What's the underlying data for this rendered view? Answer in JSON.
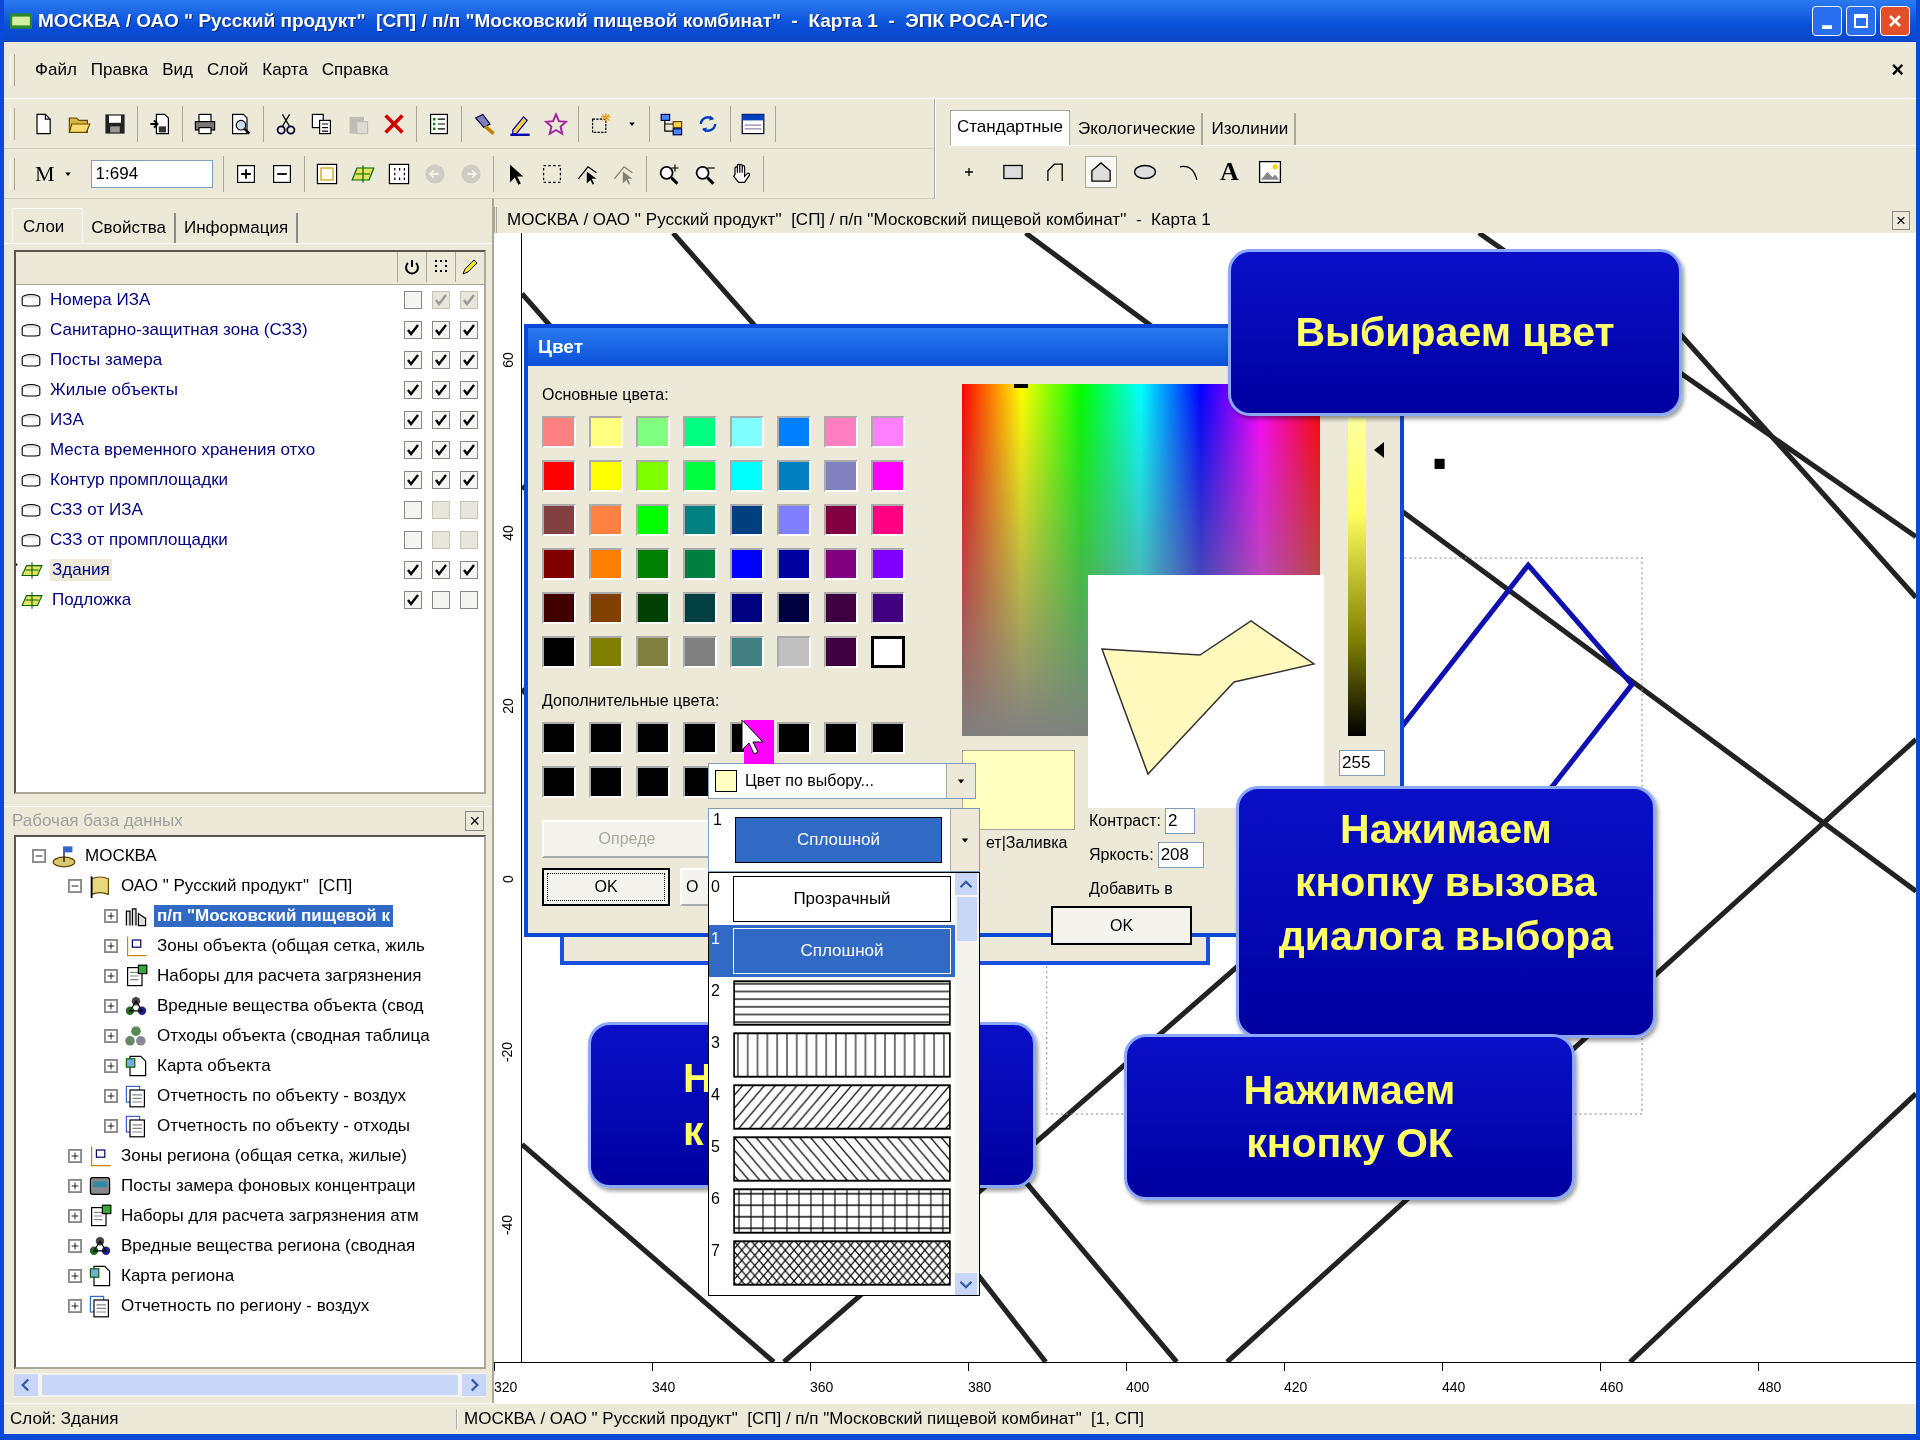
{
  "window": {
    "title": "МОСКВА / ОАО \" Русский продукт\"  [СП] / п/п \"Московский пищевой комбинат\"  -  Карта 1  -  ЭПК РОСА-ГИС"
  },
  "menu": {
    "items": [
      "Файл",
      "Правка",
      "Вид",
      "Слой",
      "Карта",
      "Справка"
    ],
    "close": "×"
  },
  "toolbar": {
    "row_1": [
      [
        {
          "disabled": false
        },
        {
          "disabled": false
        },
        {
          "disabled": false
        }
      ],
      [
        {
          "disabled": false
        }
      ],
      [
        {
          "disabled": false
        },
        {
          "disabled": false
        }
      ],
      [
        {
          "disabled": false
        },
        {
          "disabled": false
        },
        {
          "disabled": true
        },
        {
          "disabled": false
        }
      ],
      [
        {
          "disabled": false
        }
      ],
      [
        {
          "disabled": false
        },
        {
          "disabled": false
        },
        {
          "disabled": false
        }
      ],
      [
        {
          "disabled": false
        },
        {
          "disabled": false
        }
      ],
      [
        {
          "disabled": false
        },
        {
          "disabled": false
        }
      ],
      [
        {
          "disabled": false
        }
      ]
    ],
    "unit": "M",
    "scale": "1:694",
    "row_2": [
      [
        {
          "disabled": false
        },
        {
          "disabled": false
        }
      ],
      [
        {
          "disabled": false
        },
        {
          "disabled": false
        },
        {
          "disabled": false
        },
        {
          "disabled": true
        },
        {
          "disabled": true
        }
      ],
      [
        {
          "disabled": false
        },
        {
          "disabled": false
        },
        {
          "disabled": false
        },
        {
          "disabled": true
        }
      ],
      [
        {
          "disabled": false
        },
        {
          "disabled": false
        },
        {
          "disabled": false
        }
      ]
    ]
  },
  "tool_tabs": [
    {
      "label": "Стандартные",
      "selected": true
    },
    {
      "label": "Экологические",
      "selected": false
    },
    {
      "label": "Изолинии",
      "selected": false
    }
  ],
  "draw_tools": [
    {
      "kind": "icon",
      "selected": false
    },
    {
      "kind": "icon",
      "selected": false
    },
    {
      "kind": "icon",
      "selected": false
    },
    {
      "kind": "icon",
      "selected": true
    },
    {
      "kind": "icon",
      "selected": false
    },
    {
      "kind": "icon",
      "selected": false
    },
    {
      "kind": "text",
      "label": "A",
      "selected": false
    },
    {
      "kind": "icon",
      "selected": false
    }
  ],
  "side_tabs": [
    {
      "label": "Слои",
      "selected": true
    },
    {
      "label": "Свойства",
      "selected": false
    },
    {
      "label": "Информация",
      "selected": false
    }
  ],
  "layers": [
    {
      "name": "Номера ИЗА",
      "kind": "database",
      "selected": false,
      "checks": [
        {
          "checked": false,
          "disabled": false
        },
        {
          "checked": true,
          "disabled": true
        },
        {
          "checked": true,
          "disabled": true
        }
      ]
    },
    {
      "name": "Санитарно-защитная зона (СЗЗ)",
      "kind": "database",
      "selected": false,
      "checks": [
        {
          "checked": true,
          "disabled": false
        },
        {
          "checked": true,
          "disabled": false
        },
        {
          "checked": true,
          "disabled": false
        }
      ]
    },
    {
      "name": "Посты замера",
      "kind": "database",
      "selected": false,
      "checks": [
        {
          "checked": true,
          "disabled": false
        },
        {
          "checked": true,
          "disabled": false
        },
        {
          "checked": true,
          "disabled": false
        }
      ]
    },
    {
      "name": "Жилые объекты",
      "kind": "database",
      "selected": false,
      "checks": [
        {
          "checked": true,
          "disabled": false
        },
        {
          "checked": true,
          "disabled": false
        },
        {
          "checked": true,
          "disabled": false
        }
      ]
    },
    {
      "name": "ИЗА",
      "kind": "database",
      "selected": false,
      "checks": [
        {
          "checked": true,
          "disabled": false
        },
        {
          "checked": true,
          "disabled": false
        },
        {
          "checked": true,
          "disabled": false
        }
      ]
    },
    {
      "name": "Места временного хранения отхо",
      "kind": "database",
      "selected": false,
      "checks": [
        {
          "checked": true,
          "disabled": false
        },
        {
          "checked": true,
          "disabled": false
        },
        {
          "checked": true,
          "disabled": false
        }
      ]
    },
    {
      "name": "Контур промплощадки",
      "kind": "database",
      "selected": false,
      "checks": [
        {
          "checked": true,
          "disabled": false
        },
        {
          "checked": true,
          "disabled": false
        },
        {
          "checked": true,
          "disabled": false
        }
      ]
    },
    {
      "name": "СЗЗ от ИЗА",
      "kind": "database",
      "selected": false,
      "checks": [
        {
          "checked": false,
          "disabled": false
        },
        {
          "checked": false,
          "disabled": true
        },
        {
          "checked": false,
          "disabled": true
        }
      ]
    },
    {
      "name": "СЗЗ от промплощадки",
      "kind": "database",
      "selected": false,
      "checks": [
        {
          "checked": false,
          "disabled": false
        },
        {
          "checked": false,
          "disabled": true
        },
        {
          "checked": false,
          "disabled": true
        }
      ]
    },
    {
      "name": "Здания",
      "kind": "layer",
      "selected": true,
      "checks": [
        {
          "checked": true,
          "disabled": false
        },
        {
          "checked": true,
          "disabled": false
        },
        {
          "checked": true,
          "disabled": false
        }
      ]
    },
    {
      "name": "Подложка",
      "kind": "layer",
      "selected": false,
      "checks": [
        {
          "checked": true,
          "disabled": false
        },
        {
          "checked": false,
          "disabled": false
        },
        {
          "checked": false,
          "disabled": false
        }
      ]
    }
  ],
  "db_panel": {
    "title": "Рабочая база данных",
    "close": "×"
  },
  "tree": [
    {
      "label": "МОСКВА",
      "kind": "city",
      "expanded": true,
      "selected": false,
      "children": [
        {
          "label": "ОАО \" Русский продукт\"  [СП]",
          "kind": "company",
          "expanded": true,
          "selected": false,
          "children": [
            {
              "label": "п/п \"Московский пищевой к",
              "kind": "plant",
              "expanded": false,
              "selected": true
            },
            {
              "label": "Зоны объекта (общая сетка, жиль",
              "kind": "zones",
              "expanded": false,
              "selected": false
            },
            {
              "label": "Наборы для расчета загрязнения",
              "kind": "sets",
              "expanded": false,
              "selected": false
            },
            {
              "label": "Вредные вещества объекта (свод",
              "kind": "substances",
              "expanded": false,
              "selected": false
            },
            {
              "label": "Отходы объекта (сводная таблица",
              "kind": "waste",
              "expanded": false,
              "selected": false
            },
            {
              "label": "Карта объекта",
              "kind": "map",
              "expanded": false,
              "selected": false
            },
            {
              "label": "Отчетность по объекту - воздух",
              "kind": "reports",
              "expanded": false,
              "selected": false
            },
            {
              "label": "Отчетность по объекту - отходы",
              "kind": "reports",
              "expanded": false,
              "selected": false
            }
          ]
        },
        {
          "label": "Зоны региона (общая сетка, жилые)",
          "kind": "zones",
          "expanded": false,
          "selected": false
        },
        {
          "label": "Посты замера фоновых концентраци",
          "kind": "monitor",
          "expanded": false,
          "selected": false
        },
        {
          "label": "Наборы для расчета загрязнения атм",
          "kind": "sets",
          "expanded": false,
          "selected": false
        },
        {
          "label": "Вредные вещества региона (сводная",
          "kind": "substances",
          "expanded": false,
          "selected": false
        },
        {
          "label": "Карта региона",
          "kind": "map",
          "expanded": false,
          "selected": false
        },
        {
          "label": "Отчетность по региону - воздух",
          "kind": "reports",
          "expanded": false,
          "selected": false
        }
      ]
    }
  ],
  "map": {
    "caption": "МОСКВА / ОАО '' Русский продукт''  [СП] / п/п ''Московский пищевой комбинат''  -  Карта 1",
    "close": "×",
    "y_ticks": [
      "60",
      "40",
      "20",
      "0",
      "-20",
      "-40"
    ],
    "x_ticks": [
      "320",
      "340",
      "360",
      "380",
      "400",
      "420",
      "440",
      "460",
      "480"
    ]
  },
  "color_dialog": {
    "title": "Цвет",
    "basic_label": "Основные цвета:",
    "basic_colors": [
      {
        "color": "#ff8080",
        "selected": false
      },
      {
        "color": "#ffff80",
        "selected": false
      },
      {
        "color": "#80ff80",
        "selected": false
      },
      {
        "color": "#00ff80",
        "selected": false
      },
      {
        "color": "#80ffff",
        "selected": false
      },
      {
        "color": "#0080ff",
        "selected": false
      },
      {
        "color": "#ff80c0",
        "selected": false
      },
      {
        "color": "#ff80ff",
        "selected": false
      },
      {
        "color": "#ff0000",
        "selected": false
      },
      {
        "color": "#ffff00",
        "selected": false
      },
      {
        "color": "#80ff00",
        "selected": false
      },
      {
        "color": "#00ff40",
        "selected": false
      },
      {
        "color": "#00ffff",
        "selected": false
      },
      {
        "color": "#0080c0",
        "selected": false
      },
      {
        "color": "#8080c0",
        "selected": false
      },
      {
        "color": "#ff00ff",
        "selected": false
      },
      {
        "color": "#804040",
        "selected": false
      },
      {
        "color": "#ff8040",
        "selected": false
      },
      {
        "color": "#00ff00",
        "selected": false
      },
      {
        "color": "#008080",
        "selected": false
      },
      {
        "color": "#004080",
        "selected": false
      },
      {
        "color": "#8080ff",
        "selected": false
      },
      {
        "color": "#800040",
        "selected": false
      },
      {
        "color": "#ff0080",
        "selected": false
      },
      {
        "color": "#800000",
        "selected": false
      },
      {
        "color": "#ff8000",
        "selected": false
      },
      {
        "color": "#008000",
        "selected": false
      },
      {
        "color": "#008040",
        "selected": false
      },
      {
        "color": "#0000ff",
        "selected": false
      },
      {
        "color": "#0000a0",
        "selected": false
      },
      {
        "color": "#800080",
        "selected": false
      },
      {
        "color": "#8000ff",
        "selected": false
      },
      {
        "color": "#400000",
        "selected": false
      },
      {
        "color": "#804000",
        "selected": false
      },
      {
        "color": "#004000",
        "selected": false
      },
      {
        "color": "#004040",
        "selected": false
      },
      {
        "color": "#000080",
        "selected": false
      },
      {
        "color": "#000040",
        "selected": false
      },
      {
        "color": "#400040",
        "selected": false
      },
      {
        "color": "#400080",
        "selected": false
      },
      {
        "color": "#000000",
        "selected": false
      },
      {
        "color": "#808000",
        "selected": false
      },
      {
        "color": "#808040",
        "selected": false
      },
      {
        "color": "#808080",
        "selected": false
      },
      {
        "color": "#408080",
        "selected": false
      },
      {
        "color": "#c0c0c0",
        "selected": false
      },
      {
        "color": "#400040",
        "selected": false
      },
      {
        "color": "#ffffff",
        "selected": true
      }
    ],
    "custom_label": "Дополнительные цвета:",
    "custom_colors": [
      {
        "color": "#000000"
      },
      {
        "color": "#000000"
      },
      {
        "color": "#000000"
      },
      {
        "color": "#000000"
      },
      {
        "color": "#000000"
      },
      {
        "color": "#000000"
      },
      {
        "color": "#000000"
      },
      {
        "color": "#000000"
      },
      {
        "color": "#000000"
      },
      {
        "color": "#000000"
      },
      {
        "color": "#000000"
      },
      {
        "color": "#000000"
      }
    ],
    "define_button": {
      "label": "Опреде",
      "disabled": true
    },
    "ok": "OK",
    "cancel": "О",
    "luminance": {
      "level": 0.9
    },
    "value_field": "255",
    "contrast": {
      "label": "Контраст:",
      "value": "2"
    },
    "brightness": {
      "label": "Яркость:",
      "value": "208"
    },
    "fill_label": "ет|Заливка",
    "add_label": "Добавить в",
    "ok_2": "OK"
  },
  "color_combo": {
    "label": "Цвет по выбору..."
  },
  "fill_combo": {
    "number": "1",
    "label": "Сплошной"
  },
  "fill_list": [
    {
      "number": "0",
      "kind": "text",
      "label": "Прозрачный",
      "selected": false
    },
    {
      "number": "1",
      "kind": "text",
      "label": "Сплошной",
      "selected": true
    },
    {
      "number": "2",
      "kind": "horizontal",
      "selected": false
    },
    {
      "number": "3",
      "kind": "vertical",
      "selected": false
    },
    {
      "number": "4",
      "kind": "diagonal_up",
      "selected": false
    },
    {
      "number": "5",
      "kind": "diagonal_down",
      "selected": false
    },
    {
      "number": "6",
      "kind": "grid",
      "selected": false
    },
    {
      "number": "7",
      "kind": "crosshatch",
      "selected": false
    }
  ],
  "callouts": [
    {
      "lines": [
        "Выбираем цвет"
      ]
    },
    {
      "lines": [
        "Нажимаем",
        "кнопку вызова",
        "диалога выбора"
      ]
    },
    {
      "lines": [
        "Н",
        "к"
      ]
    },
    {
      "lines": [
        "Нажимаем",
        "кнопку ОК"
      ]
    }
  ],
  "status_bar": [
    "Слой: Здания",
    "МОСКВА / ОАО \" Русский продукт\"  [СП] / п/п \"Московский пищевой комбинат\"  [1, СП]"
  ]
}
